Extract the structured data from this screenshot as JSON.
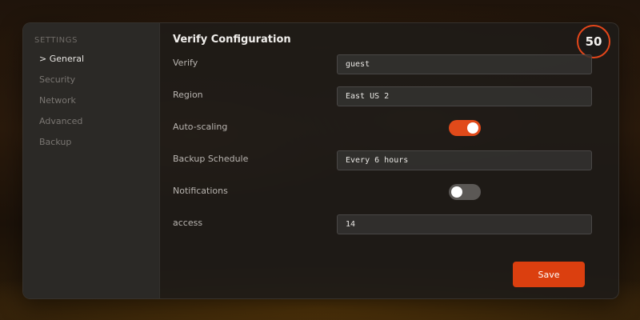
{
  "colors": {
    "accent": "#db3f0f",
    "score_ring": "#e4461a",
    "toggle_on": "#e14a1a",
    "toggle_off": "#5b5855"
  },
  "sidebar": {
    "heading": "SETTINGS",
    "items": [
      {
        "label": "> General",
        "active": true
      },
      {
        "label": "Security",
        "active": false
      },
      {
        "label": "Network",
        "active": false
      },
      {
        "label": "Advanced",
        "active": false
      },
      {
        "label": "Backup",
        "active": false
      }
    ]
  },
  "main": {
    "title": "Verify Configuration",
    "score": "50",
    "rows": [
      {
        "label": "Verify",
        "type": "input",
        "value": "guest"
      },
      {
        "label": "Region",
        "type": "input",
        "value": "East US 2"
      },
      {
        "label": "Auto-scaling",
        "type": "toggle",
        "on": true
      },
      {
        "label": "Backup Schedule",
        "type": "input",
        "value": "Every 6 hours"
      },
      {
        "label": "Notifications",
        "type": "toggle",
        "on": false
      },
      {
        "label": "access",
        "type": "input",
        "value": "14"
      }
    ],
    "save_label": "Save"
  }
}
